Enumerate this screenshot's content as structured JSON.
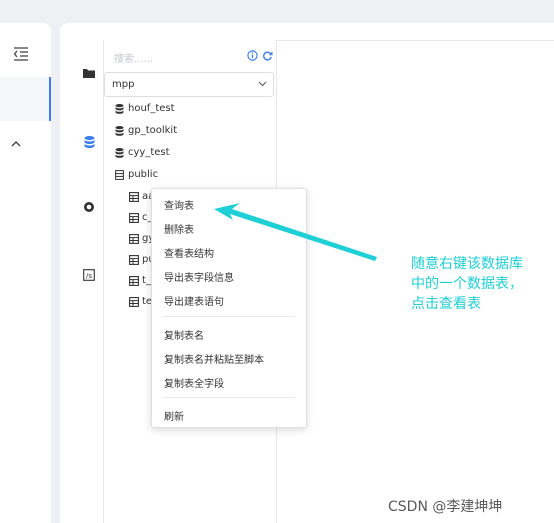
{
  "search": {
    "placeholder": "搜索......"
  },
  "schema_select": {
    "value": "mpp"
  },
  "tree": {
    "databases": [
      "houf_test",
      "gp_toolkit",
      "cyy_test",
      "public"
    ],
    "tables": [
      "aa",
      "c_",
      "gy",
      "pu",
      "t_",
      "te"
    ]
  },
  "context_menu": {
    "items": [
      "查询表",
      "删除表",
      "查看表结构",
      "导出表字段信息",
      "导出建表语句",
      "复制表名",
      "复制表名并粘贴至脚本",
      "复制表全字段",
      "刷新"
    ]
  },
  "annotation": {
    "lines": [
      "随意右键该数据库",
      "中的一个数据表，",
      "点击查看表"
    ]
  },
  "watermark": "CSDN @李建坤坤",
  "colors": {
    "accent": "#3c7ef0",
    "annotation": "#1ecfd6"
  },
  "icons": {
    "nav_collapse": "indent-icon",
    "nav_expand": "chevron-up-icon",
    "side": [
      "folder-icon",
      "database-icon",
      "target-icon",
      "code-icon"
    ],
    "info": "info-icon",
    "refresh": "refresh-icon",
    "dropdown": "chevron-down-icon",
    "database": "database-icon",
    "schema": "schema-icon",
    "table": "table-icon"
  }
}
